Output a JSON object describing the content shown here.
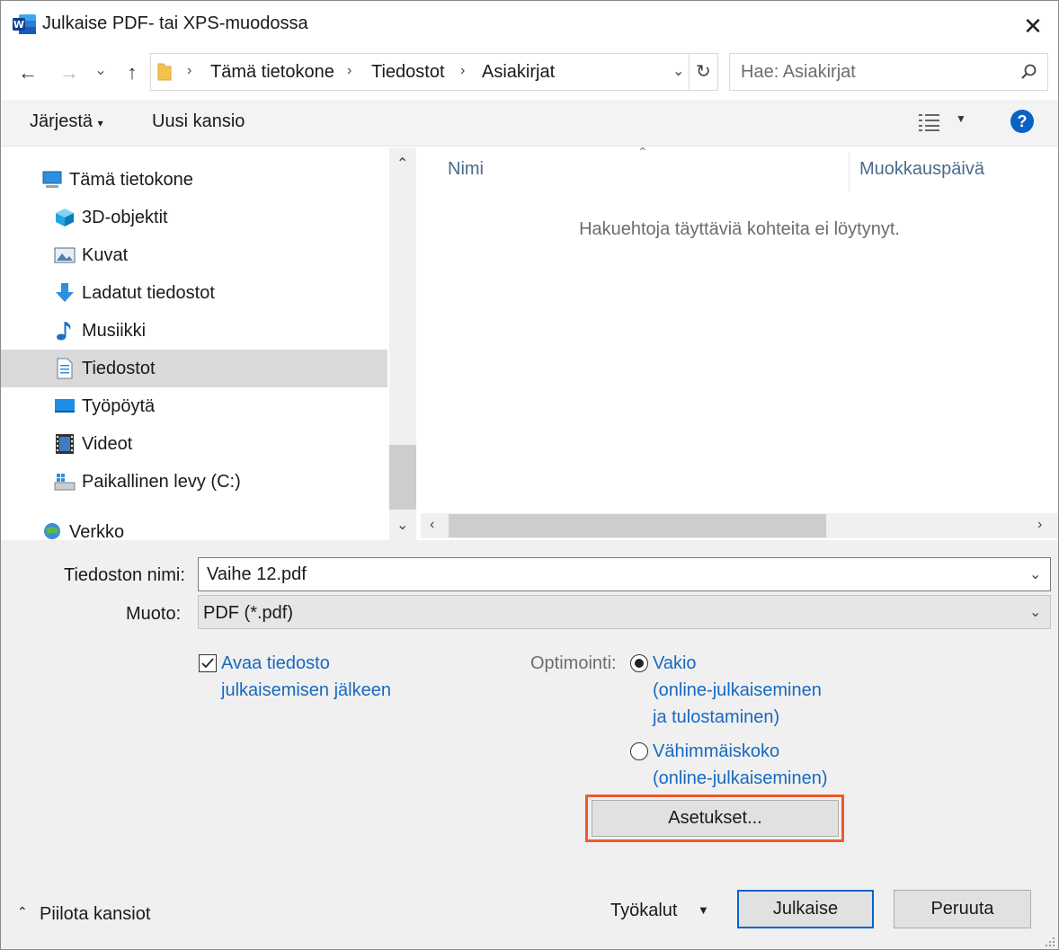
{
  "window": {
    "title": "Julkaise PDF- tai XPS-muodossa",
    "close_glyph": "✕"
  },
  "nav": {
    "back": "←",
    "forward": "→",
    "recent": "⌄",
    "up": "↑",
    "breadcrumb": [
      "Tämä tietokone",
      "Tiedostot",
      "Asiakirjat"
    ],
    "separator": "›",
    "refresh": "↻",
    "search_placeholder": "Hae: Asiakirjat"
  },
  "toolbar": {
    "organize": "Järjestä",
    "new_folder": "Uusi kansio",
    "help": "?"
  },
  "tree": {
    "items": [
      {
        "label": "Tämä tietokone",
        "icon": "computer-icon"
      },
      {
        "label": "3D-objektit",
        "icon": "3d-objects-icon"
      },
      {
        "label": "Kuvat",
        "icon": "pictures-icon"
      },
      {
        "label": "Ladatut tiedostot",
        "icon": "download-icon"
      },
      {
        "label": "Musiikki",
        "icon": "music-icon"
      },
      {
        "label": "Tiedostot",
        "icon": "documents-icon",
        "selected": true
      },
      {
        "label": "Työpöytä",
        "icon": "desktop-icon"
      },
      {
        "label": "Videot",
        "icon": "videos-icon"
      },
      {
        "label": "Paikallinen levy (C:)",
        "icon": "local-disk-icon"
      },
      {
        "label": "Verkko",
        "icon": "network-icon"
      }
    ]
  },
  "files": {
    "columns": [
      "Nimi",
      "Muokkauspäivä"
    ],
    "empty_message": "Hakuehtoja täyttäviä kohteita ei löytynyt."
  },
  "form": {
    "filename_label": "Tiedoston nimi:",
    "filename_value": "Vaihe 12.pdf",
    "format_label": "Muoto:",
    "format_value": "PDF (*.pdf)",
    "open_after_line1": "Avaa tiedosto",
    "open_after_line2": "julkaisemisen jälkeen",
    "open_after_checked": true,
    "optimize_label": "Optimointi:",
    "option_standard_line1": "Vakio",
    "option_standard_line2": "(online-julkaiseminen",
    "option_standard_line3": "ja tulostaminen)",
    "option_min_line1": "Vähimmäiskoko",
    "option_min_line2": "(online-julkaiseminen)",
    "selected_option": "Vakio",
    "settings_button": "Asetukset..."
  },
  "footer": {
    "hide_folders": "Piilota kansiot",
    "tools": "Työkalut",
    "publish": "Julkaise",
    "cancel": "Peruuta"
  },
  "colors": {
    "accent": "#0a62c6",
    "link": "#1769c0",
    "highlight": "#f0592b",
    "selected_row": "#d9d9d9"
  }
}
